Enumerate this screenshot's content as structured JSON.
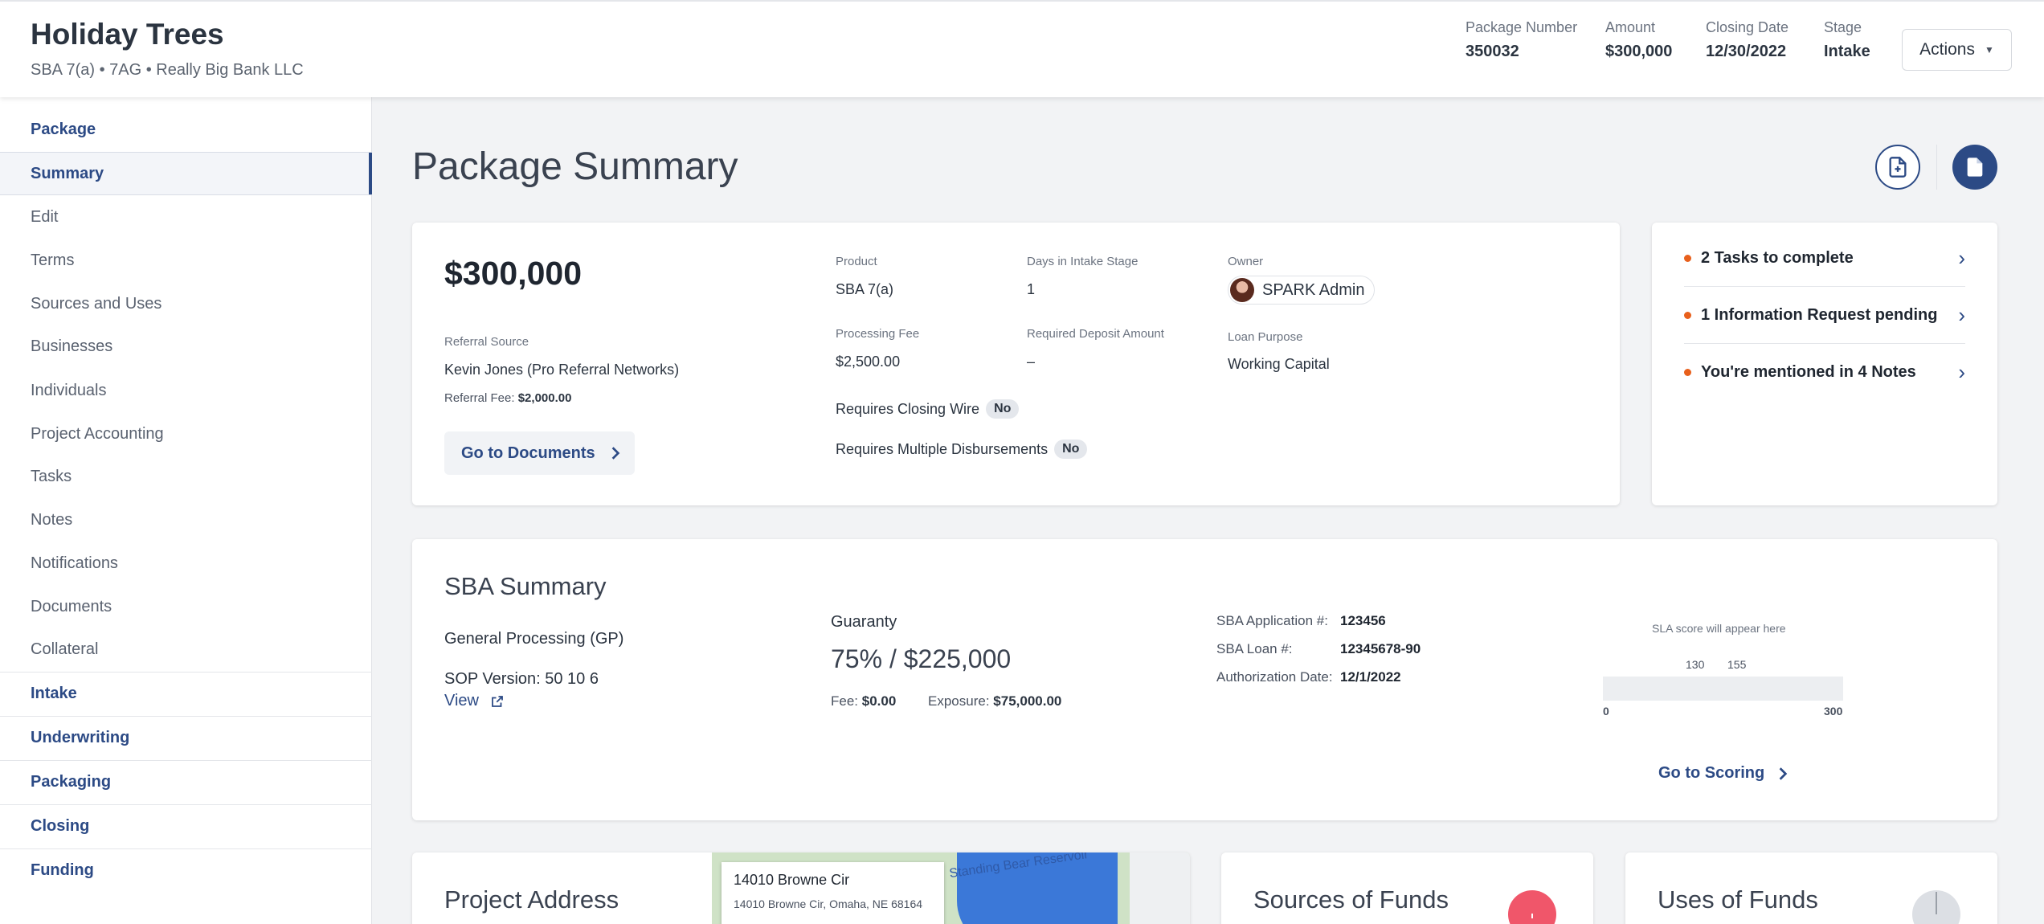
{
  "header": {
    "title": "Holiday Trees",
    "subtitle": "SBA 7(a) • 7AG • Really Big Bank LLC",
    "meta": [
      {
        "label": "Package Number",
        "value": "350032"
      },
      {
        "label": "Amount",
        "value": "$300,000"
      },
      {
        "label": "Closing Date",
        "value": "12/30/2022"
      },
      {
        "label": "Stage",
        "value": "Intake"
      }
    ],
    "actions_label": "Actions"
  },
  "sidebar": {
    "items": [
      {
        "label": "Package"
      },
      {
        "label": "Summary"
      },
      {
        "label": "Edit"
      },
      {
        "label": "Terms"
      },
      {
        "label": "Sources and Uses"
      },
      {
        "label": "Businesses"
      },
      {
        "label": "Individuals"
      },
      {
        "label": "Project Accounting"
      },
      {
        "label": "Tasks"
      },
      {
        "label": "Notes"
      },
      {
        "label": "Notifications"
      },
      {
        "label": "Documents"
      },
      {
        "label": "Collateral"
      },
      {
        "label": "Intake"
      },
      {
        "label": "Underwriting"
      },
      {
        "label": "Packaging"
      },
      {
        "label": "Closing"
      },
      {
        "label": "Funding"
      }
    ]
  },
  "main": {
    "page_title": "Package Summary",
    "summary": {
      "amount": "$300,000",
      "referral_source_label": "Referral Source",
      "referral_source": "Kevin Jones (Pro Referral Networks)",
      "referral_fee_label": "Referral Fee:",
      "referral_fee": "$2,000.00",
      "goto_documents": "Go to Documents",
      "product_label": "Product",
      "product": "SBA 7(a)",
      "days_label": "Days in Intake Stage",
      "days": "1",
      "owner_label": "Owner",
      "owner": "SPARK Admin",
      "processing_fee_label": "Processing Fee",
      "processing_fee": "$2,500.00",
      "deposit_label": "Required Deposit Amount",
      "deposit": "–",
      "loan_purpose_label": "Loan Purpose",
      "loan_purpose": "Working Capital",
      "closing_wire_label": "Requires Closing Wire",
      "closing_wire": "No",
      "multi_disb_label": "Requires Multiple Disbursements",
      "multi_disb": "No"
    },
    "tasks": [
      {
        "label": "2 Tasks to complete"
      },
      {
        "label": "1 Information Request pending"
      },
      {
        "label": "You're mentioned in 4 Notes"
      }
    ],
    "sba": {
      "title": "SBA Summary",
      "processing": "General Processing (GP)",
      "sop": "SOP Version: 50 10 6",
      "view": "View",
      "guaranty_label": "Guaranty",
      "guaranty": "75% / $225,000",
      "fee_label": "Fee:",
      "fee": "$0.00",
      "exposure_label": "Exposure:",
      "exposure": "$75,000.00",
      "app_no_label": "SBA Application #:",
      "app_no": "123456",
      "loan_no_label": "SBA Loan #:",
      "loan_no": "12345678-90",
      "auth_date_label": "Authorization Date:",
      "auth_date": "12/1/2022",
      "sla_note": "SLA score will appear here",
      "sla_mark_1": "130",
      "sla_mark_2": "155",
      "sla_min": "0",
      "sla_max": "300",
      "goto_scoring": "Go to Scoring"
    },
    "project_address": {
      "title": "Project Address",
      "street": "14010 Browne Cir",
      "full": "14010 Browne Cir, Omaha, NE 68164",
      "map_label": "Standing Bear Reservoir"
    },
    "sources": {
      "title": "Sources of Funds"
    },
    "uses": {
      "title": "Uses of Funds"
    }
  },
  "colors": {
    "primary": "#2c4a85",
    "alert": "#e8601c",
    "sources_donut": "#f0566a"
  }
}
